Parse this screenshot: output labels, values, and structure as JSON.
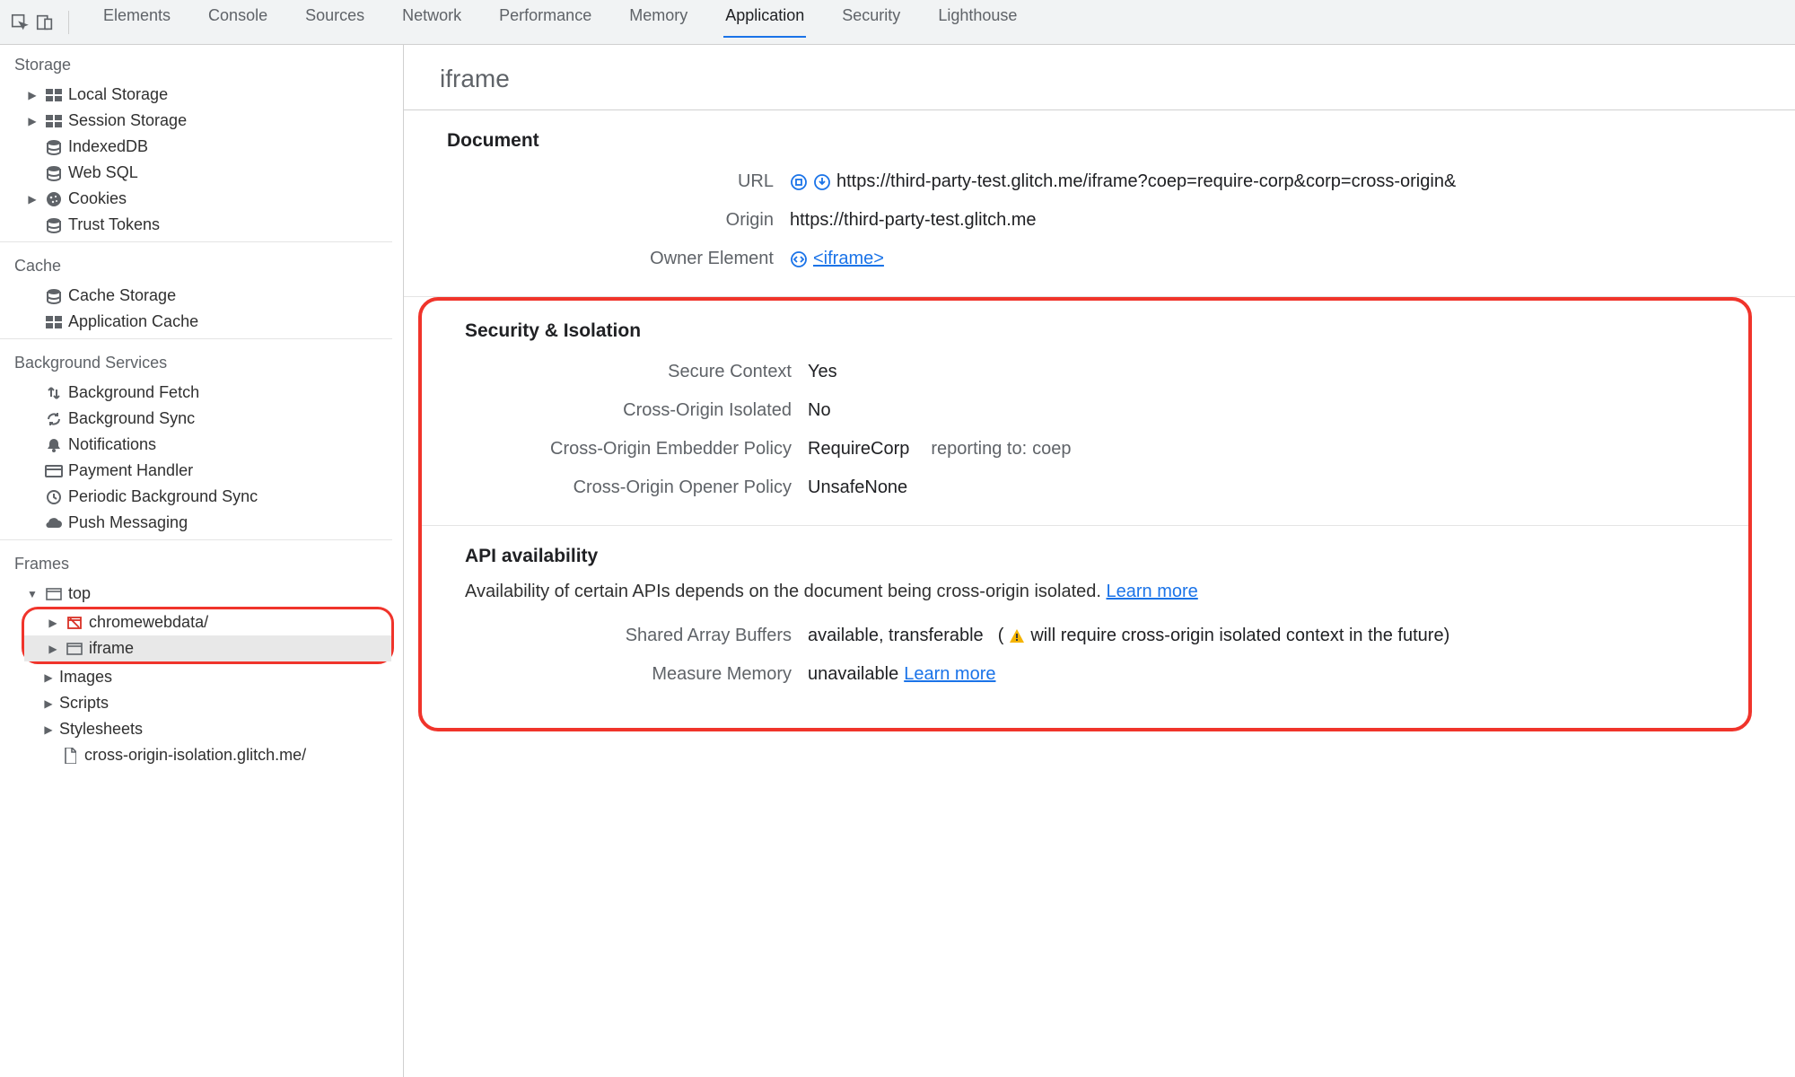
{
  "topbar": {
    "tabs": [
      "Elements",
      "Console",
      "Sources",
      "Network",
      "Performance",
      "Memory",
      "Application",
      "Security",
      "Lighthouse"
    ],
    "active": "Application"
  },
  "sidebar": {
    "sections": {
      "storage": {
        "title": "Storage",
        "items": [
          "Local Storage",
          "Session Storage",
          "IndexedDB",
          "Web SQL",
          "Cookies",
          "Trust Tokens"
        ]
      },
      "cache": {
        "title": "Cache",
        "items": [
          "Cache Storage",
          "Application Cache"
        ]
      },
      "background": {
        "title": "Background Services",
        "items": [
          "Background Fetch",
          "Background Sync",
          "Notifications",
          "Payment Handler",
          "Periodic Background Sync",
          "Push Messaging"
        ]
      },
      "frames": {
        "title": "Frames",
        "top": "top",
        "children": [
          "chromewebdata/",
          "iframe",
          "Images",
          "Scripts",
          "Stylesheets",
          "cross-origin-isolation.glitch.me/"
        ]
      }
    }
  },
  "content": {
    "title": "iframe",
    "document": {
      "heading": "Document",
      "url_label": "URL",
      "url": "https://third-party-test.glitch.me/iframe?coep=require-corp&corp=cross-origin&",
      "origin_label": "Origin",
      "origin": "https://third-party-test.glitch.me",
      "owner_label": "Owner Element",
      "owner_element": "<iframe>"
    },
    "security": {
      "heading": "Security & Isolation",
      "secure_context_label": "Secure Context",
      "secure_context": "Yes",
      "coi_label": "Cross-Origin Isolated",
      "coi": "No",
      "coep_label": "Cross-Origin Embedder Policy",
      "coep": "RequireCorp",
      "coep_reporting_label": "reporting to:",
      "coep_reporting": "coep",
      "coop_label": "Cross-Origin Opener Policy",
      "coop": "UnsafeNone"
    },
    "api": {
      "heading": "API availability",
      "description": "Availability of certain APIs depends on the document being cross-origin isolated.",
      "learn_more": "Learn more",
      "sab_label": "Shared Array Buffers",
      "sab_value": "available, transferable",
      "sab_warning": "will require cross-origin isolated context in the future)",
      "mm_label": "Measure Memory",
      "mm_value": "unavailable"
    }
  }
}
